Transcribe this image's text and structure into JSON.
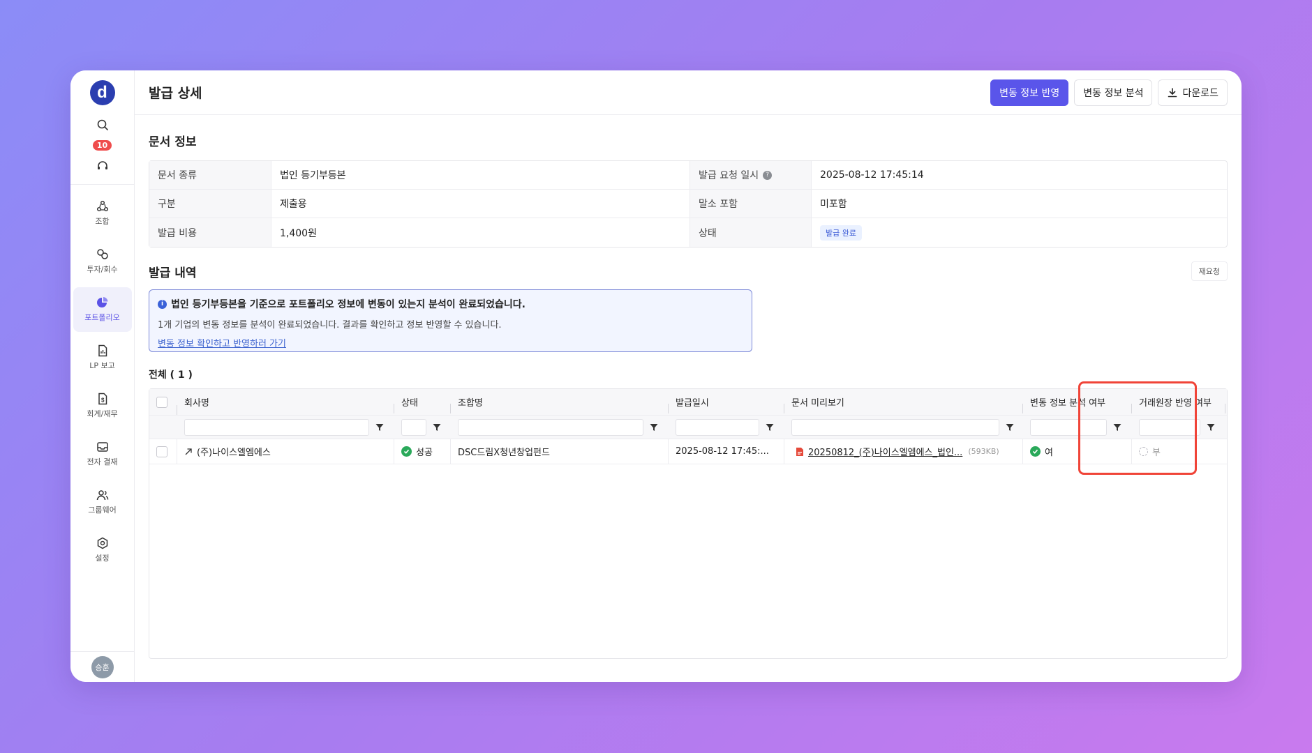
{
  "sidebar": {
    "logo": "d",
    "notification_count": "10",
    "items": [
      {
        "label": "조합",
        "active": false
      },
      {
        "label": "투자/회수",
        "active": false
      },
      {
        "label": "포트폴리오",
        "active": true
      },
      {
        "label": "LP 보고",
        "active": false
      },
      {
        "label": "회계/재무",
        "active": false
      },
      {
        "label": "전자 결재",
        "active": false
      },
      {
        "label": "그룹웨어",
        "active": false
      },
      {
        "label": "설정",
        "active": false
      }
    ],
    "avatar": "승훈"
  },
  "header": {
    "title": "발급 상세",
    "btn_apply": "변동 정보 반영",
    "btn_analyze": "변동 정보 분석",
    "btn_download": "다운로드"
  },
  "doc_info": {
    "title": "문서 정보",
    "rows": [
      {
        "label1": "문서 종류",
        "value1": "법인 등기부등본",
        "label2": "발급 요청 일시",
        "value2": "2025-08-12 17:45:14"
      },
      {
        "label1": "구분",
        "value1": "제출용",
        "label2": "말소 포함",
        "value2": "미포함"
      },
      {
        "label1": "발급 비용",
        "value1": "1,400원",
        "label2": "상태",
        "value2": "발급 완료"
      }
    ]
  },
  "history": {
    "title": "발급 내역",
    "retry_label": "재요청",
    "notice": {
      "title": "법인 등기부등본을 기준으로 포트폴리오 정보에 변동이 있는지 분석이 완료되었습니다.",
      "text": "1개 기업의 변동 정보를 분석이 완료되었습니다. 결과를 확인하고 정보 반영할 수 있습니다.",
      "link": "변동 정보 확인하고 반영하러 가기"
    },
    "total_label": "전체 ( 1 )"
  },
  "grid": {
    "columns": [
      "회사명",
      "상태",
      "조합명",
      "발급일시",
      "문서 미리보기",
      "변동 정보 분석 여부",
      "거래원장 반영 여부"
    ],
    "rows": [
      {
        "company": "(주)나이스엘엠에스",
        "status": "성공",
        "fund": "DSC드림X청년창업펀드",
        "issued_at": "2025-08-12 17:45:...",
        "file_name": "20250812_(주)나이스엘엠에스_법인...",
        "file_size": "(593KB)",
        "analysis": "여",
        "ledger": "부"
      }
    ]
  },
  "colors": {
    "primary": "#5a55ea",
    "success": "#2aa95a",
    "highlight": "#f04438",
    "badge": "#ef4d4d"
  }
}
